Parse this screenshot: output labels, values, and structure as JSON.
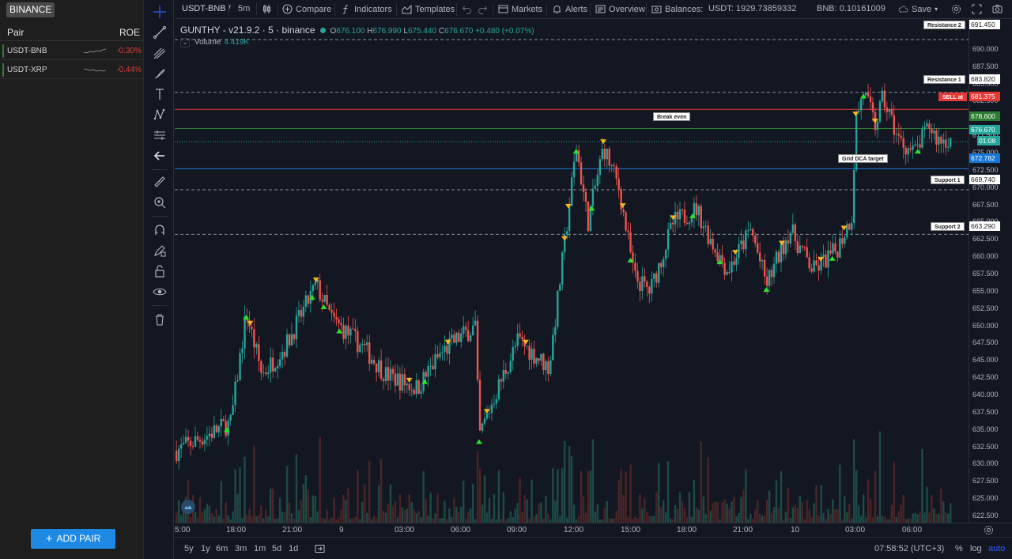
{
  "panel": {
    "exchange_tab": "BINANCE",
    "col_pair": "Pair",
    "col_roe": "ROE",
    "pairs": [
      {
        "name": "USDT-BNB",
        "roe": "-0.30%"
      },
      {
        "name": "USDT-XRP",
        "roe": "-0.44%"
      }
    ],
    "add_pair": "ADD PAIR"
  },
  "toolbar": {
    "symbol": "USDT-BNB /",
    "interval": "5m",
    "compare": "Compare",
    "indicators": "Indicators",
    "templates": "Templates",
    "markets": "Markets",
    "alerts": "Alerts",
    "overview": "Overview",
    "balances_label": "Balances:",
    "usdt_balance": "USDT: 1929.73859332",
    "bnb_balance": "BNB: 0.10161009",
    "save": "Save"
  },
  "legend": {
    "title": "GUNTHY - v21.9.2 · 5 · binance",
    "open_label": "O",
    "open": "676.100",
    "high_label": "H",
    "high": "676.990",
    "low_label": "L",
    "low": "675.440",
    "close_label": "C",
    "close": "676.670",
    "change": "+0.480 (+0.07%)",
    "volume_label": "Volume",
    "volume_value": "4.419K"
  },
  "price_axis": {
    "ticks": [
      "690.000",
      "687.500",
      "685.000",
      "682.500",
      "680.000",
      "677.500",
      "675.000",
      "672.500",
      "670.000",
      "667.500",
      "665.000",
      "662.500",
      "660.000",
      "657.500",
      "655.000",
      "652.500",
      "650.000",
      "647.500",
      "645.000",
      "642.500",
      "640.000",
      "637.500",
      "635.000",
      "632.500",
      "630.000",
      "627.500",
      "625.000",
      "622.500"
    ],
    "resistance2": "691.450",
    "resistance1": "683.820",
    "sell": "681.375",
    "break_even": "678.600",
    "last": "676.670",
    "countdown": "01:08",
    "grid_dca": "672.782",
    "support1": "669.740",
    "support2": "663.290"
  },
  "levels": {
    "resistance2": "Resistance 2",
    "resistance1": "Resistance 1",
    "sell": "SELL at",
    "break_even": "Break even",
    "grid_dca": "Grid DCA target",
    "support1": "Support 1",
    "support2": "Support 2"
  },
  "time_axis": {
    "ticks": [
      "5:00",
      "18:00",
      "21:00",
      "9",
      "03:00",
      "06:00",
      "09:00",
      "12:00",
      "15:00",
      "18:00",
      "21:00",
      "10",
      "03:00",
      "06:00"
    ]
  },
  "bottom": {
    "ranges": [
      "5y",
      "1y",
      "6m",
      "3m",
      "1m",
      "5d",
      "1d"
    ],
    "clock": "07:58:52 (UTC+3)",
    "percent": "%",
    "log": "log",
    "auto": "auto"
  },
  "colors": {
    "up": "#26a69a",
    "down": "#ef5350",
    "background": "#131722",
    "accent": "#1e88e5",
    "sell_line": "#e53935",
    "break_even_line": "#2e7d32",
    "dca_line": "#1976d2"
  },
  "chart_data": {
    "type": "candlestick",
    "symbol": "USDT-BNB",
    "interval": "5m",
    "ylim": [
      622.5,
      692.5
    ],
    "x": [
      "5:00",
      "18:00",
      "21:00",
      "9",
      "03:00",
      "06:00",
      "09:00",
      "12:00",
      "15:00",
      "18:00",
      "21:00",
      "10",
      "03:00",
      "06:00"
    ],
    "close_path": [
      [
        0,
        632.0
      ],
      [
        0.07,
        636.0
      ],
      [
        0.09,
        652.0
      ],
      [
        0.11,
        643.0
      ],
      [
        0.14,
        647.0
      ],
      [
        0.18,
        656.0
      ],
      [
        0.2,
        651.0
      ],
      [
        0.24,
        647.0
      ],
      [
        0.27,
        643.0
      ],
      [
        0.31,
        641.0
      ],
      [
        0.34,
        646.0
      ],
      [
        0.36,
        648.0
      ],
      [
        0.385,
        650.0
      ],
      [
        0.39,
        634.0
      ],
      [
        0.41,
        640.0
      ],
      [
        0.44,
        648.0
      ],
      [
        0.46,
        646.0
      ],
      [
        0.48,
        644.0
      ],
      [
        0.5,
        662.0
      ],
      [
        0.515,
        676.0
      ],
      [
        0.53,
        665.0
      ],
      [
        0.55,
        676.0
      ],
      [
        0.57,
        670.0
      ],
      [
        0.59,
        657.0
      ],
      [
        0.61,
        655.0
      ],
      [
        0.64,
        665.0
      ],
      [
        0.67,
        667.0
      ],
      [
        0.69,
        662.0
      ],
      [
        0.71,
        658.0
      ],
      [
        0.74,
        664.0
      ],
      [
        0.76,
        656.0
      ],
      [
        0.79,
        664.0
      ],
      [
        0.82,
        658.0
      ],
      [
        0.85,
        661.0
      ],
      [
        0.87,
        666.0
      ],
      [
        0.875,
        680.0
      ],
      [
        0.885,
        684.0
      ],
      [
        0.9,
        679.0
      ],
      [
        0.91,
        683.0
      ],
      [
        0.93,
        677.0
      ],
      [
        0.95,
        675.0
      ],
      [
        0.97,
        679.0
      ],
      [
        0.98,
        677.0
      ]
    ],
    "levels": {
      "resistance_2": 691.45,
      "resistance_1": 683.82,
      "sell_at": 681.375,
      "break_even": 678.6,
      "last_price": 676.67,
      "grid_dca_target": 672.782,
      "support_1": 669.74,
      "support_2": 663.29
    }
  }
}
